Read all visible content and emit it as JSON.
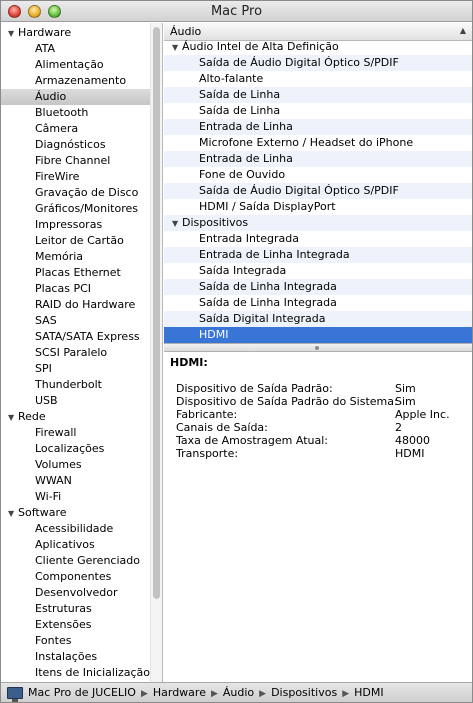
{
  "window": {
    "title": "Mac Pro"
  },
  "sidebar": {
    "rows": [
      {
        "type": "section",
        "label": "Hardware"
      },
      {
        "type": "item",
        "label": "ATA"
      },
      {
        "type": "item",
        "label": "Alimentação"
      },
      {
        "type": "item",
        "label": "Armazenamento"
      },
      {
        "type": "item",
        "label": "Áudio",
        "selected": true
      },
      {
        "type": "item",
        "label": "Bluetooth"
      },
      {
        "type": "item",
        "label": "Câmera"
      },
      {
        "type": "item",
        "label": "Diagnósticos"
      },
      {
        "type": "item",
        "label": "Fibre Channel"
      },
      {
        "type": "item",
        "label": "FireWire"
      },
      {
        "type": "item",
        "label": "Gravação de Disco"
      },
      {
        "type": "item",
        "label": "Gráficos/Monitores"
      },
      {
        "type": "item",
        "label": "Impressoras"
      },
      {
        "type": "item",
        "label": "Leitor de Cartão"
      },
      {
        "type": "item",
        "label": "Memória"
      },
      {
        "type": "item",
        "label": "Placas Ethernet"
      },
      {
        "type": "item",
        "label": "Placas PCI"
      },
      {
        "type": "item",
        "label": "RAID do Hardware"
      },
      {
        "type": "item",
        "label": "SAS"
      },
      {
        "type": "item",
        "label": "SATA/SATA Express"
      },
      {
        "type": "item",
        "label": "SCSI Paralelo"
      },
      {
        "type": "item",
        "label": "SPI"
      },
      {
        "type": "item",
        "label": "Thunderbolt"
      },
      {
        "type": "item",
        "label": "USB"
      },
      {
        "type": "section",
        "label": "Rede"
      },
      {
        "type": "item",
        "label": "Firewall"
      },
      {
        "type": "item",
        "label": "Localizações"
      },
      {
        "type": "item",
        "label": "Volumes"
      },
      {
        "type": "item",
        "label": "WWAN"
      },
      {
        "type": "item",
        "label": "Wi-Fi"
      },
      {
        "type": "section",
        "label": "Software"
      },
      {
        "type": "item",
        "label": "Acessibilidade"
      },
      {
        "type": "item",
        "label": "Aplicativos"
      },
      {
        "type": "item",
        "label": "Cliente Gerenciado"
      },
      {
        "type": "item",
        "label": "Componentes"
      },
      {
        "type": "item",
        "label": "Desenvolvedor"
      },
      {
        "type": "item",
        "label": "Estruturas"
      },
      {
        "type": "item",
        "label": "Extensões"
      },
      {
        "type": "item",
        "label": "Fontes"
      },
      {
        "type": "item",
        "label": "Instalações"
      },
      {
        "type": "item",
        "label": "Itens de Inicialização"
      }
    ]
  },
  "table": {
    "header": "Áudio",
    "rows": [
      {
        "type": "group",
        "label": "Áudio Intel de Alta Definição"
      },
      {
        "type": "child",
        "label": "Saída de Áudio Digital Óptico S/PDIF"
      },
      {
        "type": "child",
        "label": "Alto-falante"
      },
      {
        "type": "child",
        "label": "Saída de Linha"
      },
      {
        "type": "child",
        "label": "Saída de Linha"
      },
      {
        "type": "child",
        "label": "Entrada de Linha"
      },
      {
        "type": "child",
        "label": "Microfone Externo / Headset do iPhone"
      },
      {
        "type": "child",
        "label": "Entrada de Linha"
      },
      {
        "type": "child",
        "label": "Fone de Ouvido"
      },
      {
        "type": "child",
        "label": "Saída de Áudio Digital Óptico S/PDIF"
      },
      {
        "type": "child",
        "label": "HDMI / Saída DisplayPort"
      },
      {
        "type": "group",
        "label": "Dispositivos"
      },
      {
        "type": "child",
        "label": "Entrada Integrada"
      },
      {
        "type": "child",
        "label": "Entrada de Linha Integrada"
      },
      {
        "type": "child",
        "label": "Saída Integrada"
      },
      {
        "type": "child",
        "label": "Saída de Linha Integrada"
      },
      {
        "type": "child",
        "label": "Saída de Linha Integrada"
      },
      {
        "type": "child",
        "label": "Saída Digital Integrada"
      },
      {
        "type": "child",
        "label": "HDMI",
        "selected": true
      }
    ]
  },
  "detail": {
    "title": "HDMI:",
    "properties": [
      {
        "key": "Dispositivo de Saída Padrão:",
        "value": "Sim"
      },
      {
        "key": "Dispositivo de Saída Padrão do Sistema:",
        "value": "Sim"
      },
      {
        "key": "Fabricante:",
        "value": "Apple Inc."
      },
      {
        "key": "Canais de Saída:",
        "value": "2"
      },
      {
        "key": "Taxa de Amostragem Atual:",
        "value": "48000"
      },
      {
        "key": "Transporte:",
        "value": "HDMI"
      }
    ]
  },
  "statusbar": {
    "icon": "mac-pro-icon",
    "breadcrumbs": [
      "Mac Pro de JUCELIO",
      "Hardware",
      "Áudio",
      "Dispositivos",
      "HDMI"
    ]
  },
  "colors": {
    "selection": "#3875d7",
    "alternate_row": "#eef3fb"
  }
}
